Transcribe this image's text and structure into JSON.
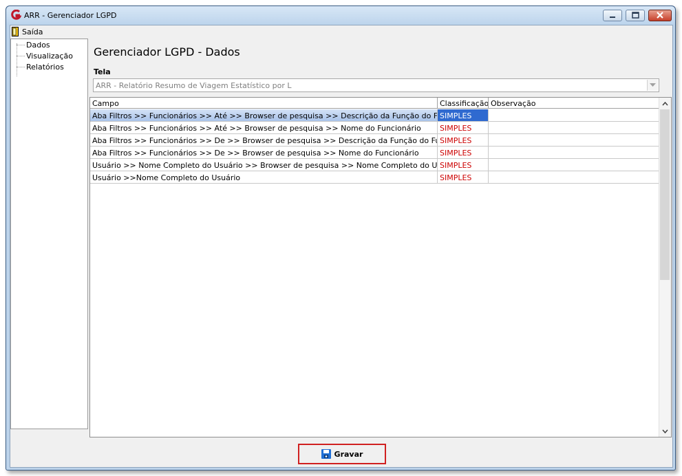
{
  "window": {
    "title": "ARR - Gerenciador LGPD"
  },
  "menu": {
    "exit_label": "Saída"
  },
  "nav": {
    "items": [
      {
        "label": "Dados"
      },
      {
        "label": "Visualização"
      },
      {
        "label": "Relatórios"
      }
    ]
  },
  "page": {
    "title": "Gerenciador LGPD - Dados"
  },
  "tela": {
    "label": "Tela",
    "selected": "ARR - Relatório Resumo de Viagem Estatístico por L"
  },
  "grid": {
    "columns": [
      "Campo",
      "Classificação",
      "Observação"
    ],
    "rows": [
      {
        "campo": "Aba Filtros >> Funcionários >> Até >> Browser de pesquisa >> Descrição da Função do Funcionário",
        "classificacao": "SIMPLES",
        "observacao": ""
      },
      {
        "campo": "Aba Filtros >> Funcionários >> Até >> Browser de pesquisa >> Nome do Funcionário",
        "classificacao": "SIMPLES",
        "observacao": ""
      },
      {
        "campo": "Aba Filtros >> Funcionários >> De >> Browser de pesquisa >> Descrição da Função do Funcionário",
        "classificacao": "SIMPLES",
        "observacao": ""
      },
      {
        "campo": "Aba Filtros >> Funcionários >> De >> Browser de pesquisa >> Nome do Funcionário",
        "classificacao": "SIMPLES",
        "observacao": ""
      },
      {
        "campo": "Usuário >> Nome Completo do Usuário >> Browser de pesquisa >> Nome Completo do Usuário",
        "classificacao": "SIMPLES",
        "observacao": ""
      },
      {
        "campo": "Usuário >>Nome Completo do Usuário",
        "classificacao": "SIMPLES",
        "observacao": ""
      }
    ]
  },
  "actions": {
    "save_label": "Gravar"
  },
  "colors": {
    "classification": "#cc0000",
    "selection": "#2f6ad0",
    "highlight_border": "#d02020"
  }
}
